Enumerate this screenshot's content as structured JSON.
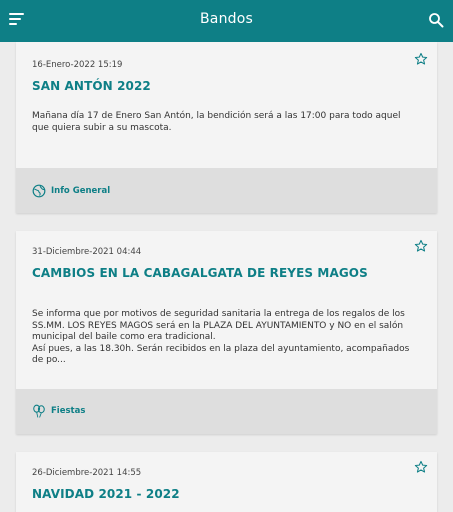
{
  "appbar": {
    "title": "Bandos",
    "menu_icon": "menu-icon",
    "search_icon": "search-icon",
    "color": "#0e7f86"
  },
  "cards": [
    {
      "date": "16-Enero-2022 15:19",
      "title": "SAN ANTÓN 2022",
      "body_lines": [
        "Mañana día 17 de Enero San Antón,  la bendición será a las 17:00 para todo aquel",
        "que quiera subir a su mascota."
      ],
      "category": "Info General",
      "category_icon": "globe-icon",
      "favorite_icon": "star-outline-icon"
    },
    {
      "date": "31-Diciembre-2021 04:44",
      "title": "CAMBIOS EN LA CABAGALGATA DE REYES MAGOS",
      "body_lines": [
        "Se informa que por motivos de seguridad sanitaria la entrega de los regalos de los",
        "SS.MM. LOS REYES MAGOS será en la PLAZA DEL AYUNTAMIENTO y NO en el salón",
        "municipal del baile como era tradicional.",
        "Así pues, a las 18.30h. Serán recibidos en la plaza del ayuntamiento, acompañados",
        "de po..."
      ],
      "category": "Fiestas",
      "category_icon": "balloons-icon",
      "favorite_icon": "star-outline-icon"
    },
    {
      "date": "26-Diciembre-2021 14:55",
      "title": "NAVIDAD 2021 - 2022",
      "favorite_icon": "star-outline-icon"
    }
  ]
}
